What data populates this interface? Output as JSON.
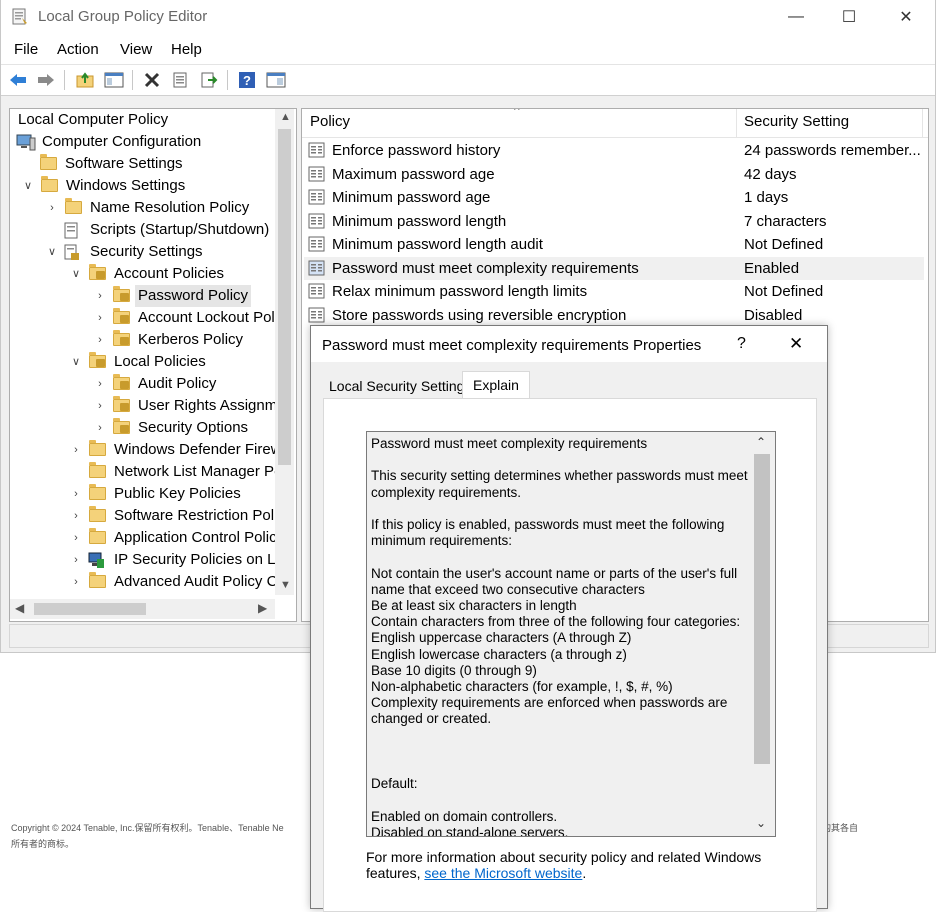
{
  "window": {
    "title": "Local Group Policy Editor",
    "minimize": "—",
    "maximize": "☐",
    "close": "✕"
  },
  "menu": [
    "File",
    "Action",
    "View",
    "Help"
  ],
  "tree": {
    "root": "Local Computer Policy",
    "computer_config": "Computer Configuration",
    "software_settings": "Software Settings",
    "windows_settings": "Windows Settings",
    "name_resolution": "Name Resolution Policy",
    "scripts": "Scripts (Startup/Shutdown)",
    "security_settings": "Security Settings",
    "account_policies": "Account Policies",
    "password_policy": "Password Policy",
    "account_lockout": "Account Lockout Pol",
    "kerberos": "Kerberos Policy",
    "local_policies": "Local Policies",
    "audit_policy": "Audit Policy",
    "user_rights": "User Rights Assignm",
    "security_options": "Security Options",
    "defender_firewall": "Windows Defender Firew",
    "network_list": "Network List Manager Po",
    "public_key": "Public Key Policies",
    "software_restriction": "Software Restriction Poli",
    "application_control": "Application Control Polic",
    "ip_security": "IP Security Policies on Lo",
    "advanced_audit": "Advanced Audit Policy C"
  },
  "list": {
    "col_policy": "Policy",
    "col_setting": "Security Setting",
    "rows": [
      {
        "policy": "Enforce password history",
        "setting": "24 passwords remember..."
      },
      {
        "policy": "Maximum password age",
        "setting": "42 days"
      },
      {
        "policy": "Minimum password age",
        "setting": "1 days"
      },
      {
        "policy": "Minimum password length",
        "setting": "7 characters"
      },
      {
        "policy": "Minimum password length audit",
        "setting": "Not Defined"
      },
      {
        "policy": "Password must meet complexity requirements",
        "setting": "Enabled"
      },
      {
        "policy": "Relax minimum password length limits",
        "setting": "Not Defined"
      },
      {
        "policy": "Store passwords using reversible encryption",
        "setting": "Disabled"
      }
    ]
  },
  "copyright": {
    "line1": "Copyright © 2024 Tenable, Inc.保留所有权利。Tenable、Tenable Ne",
    "line2": "所有者的商标。",
    "line3": "的其各自"
  },
  "dialog": {
    "title": "Password must meet complexity requirements Properties",
    "help": "?",
    "close": "✕",
    "tab_local": "Local Security Setting",
    "tab_explain": "Explain",
    "explain_lines": [
      "Password must meet complexity requirements",
      "",
      "This security setting determines whether passwords must meet",
      "complexity requirements.",
      "",
      "If this policy is enabled, passwords must meet the following",
      "minimum requirements:",
      "",
      "Not contain the user's account name or parts of the user's full",
      "name that exceed two consecutive characters",
      "Be at least six characters in length",
      "Contain characters from three of the following four categories:",
      "English uppercase characters (A through Z)",
      "English lowercase characters (a through z)",
      "Base 10 digits (0 through 9)",
      "Non-alphabetic characters (for example, !, $, #, %)",
      "Complexity requirements are enforced when passwords are",
      "changed or created.",
      "",
      "",
      "",
      "Default:",
      "",
      "Enabled on domain controllers.",
      "Disabled on stand-alone servers."
    ],
    "more_info_text": "For more information about security policy and related Windows features,",
    "more_info_link": "see the Microsoft website",
    "more_info_end": "."
  }
}
